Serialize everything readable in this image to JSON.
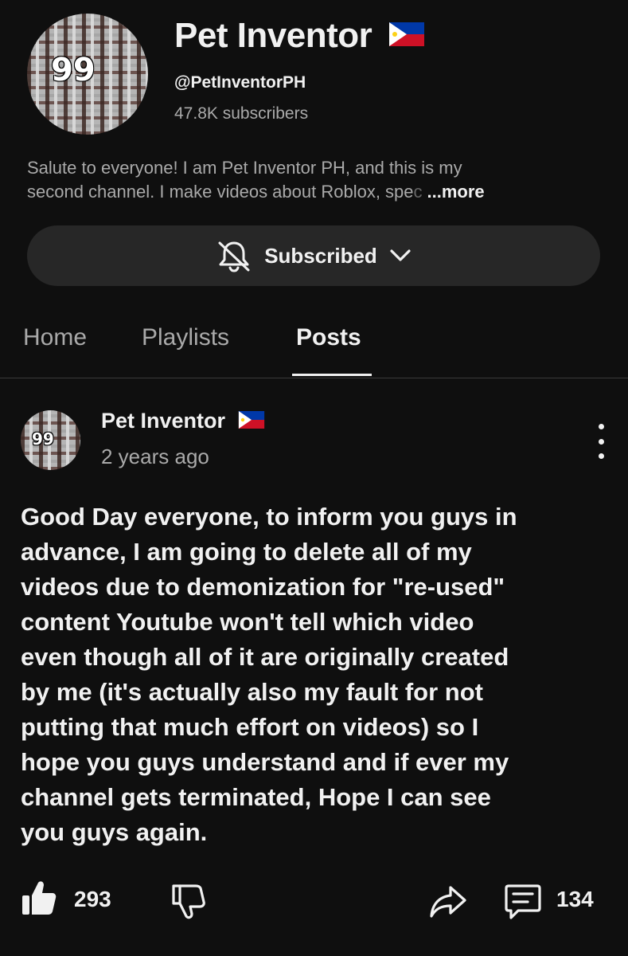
{
  "channel": {
    "name": "Pet Inventor",
    "handle": "@PetInventorPH",
    "subscribers": "47.8K subscribers",
    "avatar_badge": "99",
    "description_line1": "Salute to everyone! I am Pet Inventor PH, and this is my",
    "description_line2": "second channel. I make videos about Roblox, spe",
    "description_fade": "c",
    "more_label": "...more"
  },
  "subscribe_button": {
    "label": "Subscribed",
    "bell_icon": "bell-slash-icon",
    "chevron_icon": "chevron-down-icon"
  },
  "tabs": [
    {
      "label": "Home",
      "active": false
    },
    {
      "label": "Playlists",
      "active": false
    },
    {
      "label": "Posts",
      "active": true
    }
  ],
  "post": {
    "author": "Pet Inventor",
    "time": "2 years ago",
    "avatar_badge": "99",
    "body": "Good Day everyone, to inform you guys in\nadvance, I am going to delete all of my\nvideos due to demonization for \"re-used\"\ncontent Youtube won't tell which video\neven though all of it are originally created\nby me (it's actually also my fault for not\nputting that much effort on videos) so I\nhope you guys understand and if ever my\nchannel gets terminated, Hope I can see\nyou guys again.",
    "likes": "293",
    "comments": "134"
  },
  "colors": {
    "background": "#0f0f0f",
    "button_bg": "#272727",
    "secondary_text": "#aaaaaa",
    "flag_blue": "#0038a8",
    "flag_red": "#ce1126",
    "flag_white": "#ffffff",
    "flag_yellow": "#fcd116"
  }
}
